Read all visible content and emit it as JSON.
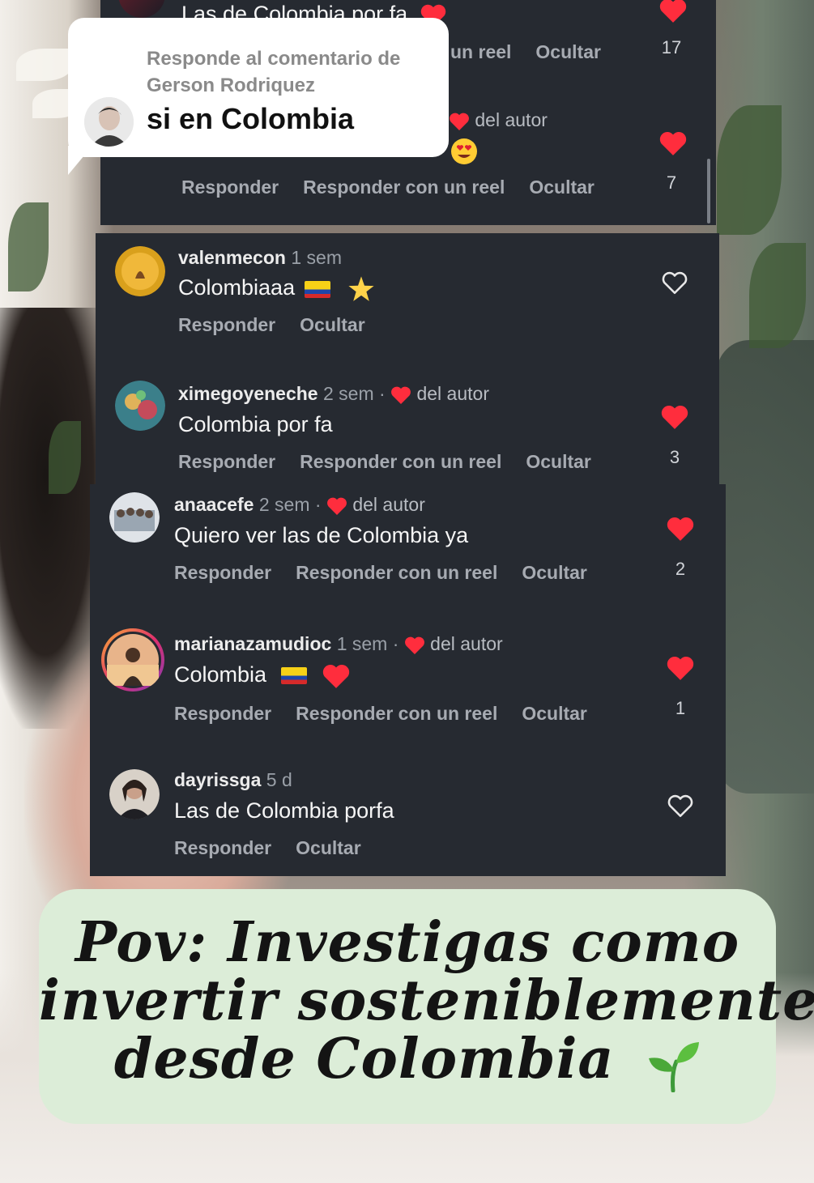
{
  "reply_bubble": {
    "label": "Responde al comentario de Gerson Rodriquez",
    "text": "si en Colombia"
  },
  "top_partial": {
    "comment1_text": "Las de Colombia por fa",
    "comment1_actions": [
      "un reel",
      "Ocultar"
    ],
    "comment1_likes": "17",
    "comment2_author_tag": "del autor",
    "comment2_actions": [
      "Responder",
      "Responder con un reel",
      "Ocultar"
    ],
    "comment2_likes": "7"
  },
  "comments": [
    {
      "username": "valenmecon",
      "time": "1 sem",
      "author_liked": false,
      "text": "Colombiaaa",
      "actions": [
        "Responder",
        "Ocultar"
      ],
      "liked": false,
      "likes": ""
    },
    {
      "username": "ximegoyeneche",
      "time": "2 sem",
      "author_liked": true,
      "author_tag": "del autor",
      "text": "Colombia por fa",
      "actions": [
        "Responder",
        "Responder con un reel",
        "Ocultar"
      ],
      "liked": true,
      "likes": "3"
    },
    {
      "username": "anaacefe",
      "time": "2 sem",
      "author_liked": true,
      "author_tag": "del autor",
      "text": "Quiero ver las de Colombia ya",
      "actions": [
        "Responder",
        "Responder con un reel",
        "Ocultar"
      ],
      "liked": true,
      "likes": "2"
    },
    {
      "username": "marianazamudioc",
      "time": "1 sem",
      "author_liked": true,
      "author_tag": "del autor",
      "text": "Colombia",
      "actions": [
        "Responder",
        "Responder con un reel",
        "Ocultar"
      ],
      "liked": true,
      "likes": "1"
    },
    {
      "username": "dayrissga",
      "time": "5 d",
      "author_liked": false,
      "text": "Las de Colombia porfa",
      "actions": [
        "Responder",
        "Ocultar"
      ],
      "liked": false,
      "likes": ""
    }
  ],
  "separator": "·",
  "caption": {
    "line1": "Pov: Investigas como",
    "line2": "invertir sosteniblemente",
    "line3": "desde Colombia"
  },
  "colors": {
    "panel": "#262a31",
    "heart_red": "#ff2d3d",
    "caption_bg": "#dcedd8"
  },
  "icons": [
    "heart-icon",
    "heart-outline-icon",
    "colombia-flag-icon",
    "star-icon",
    "heart-eyes-icon",
    "sprout-icon"
  ]
}
